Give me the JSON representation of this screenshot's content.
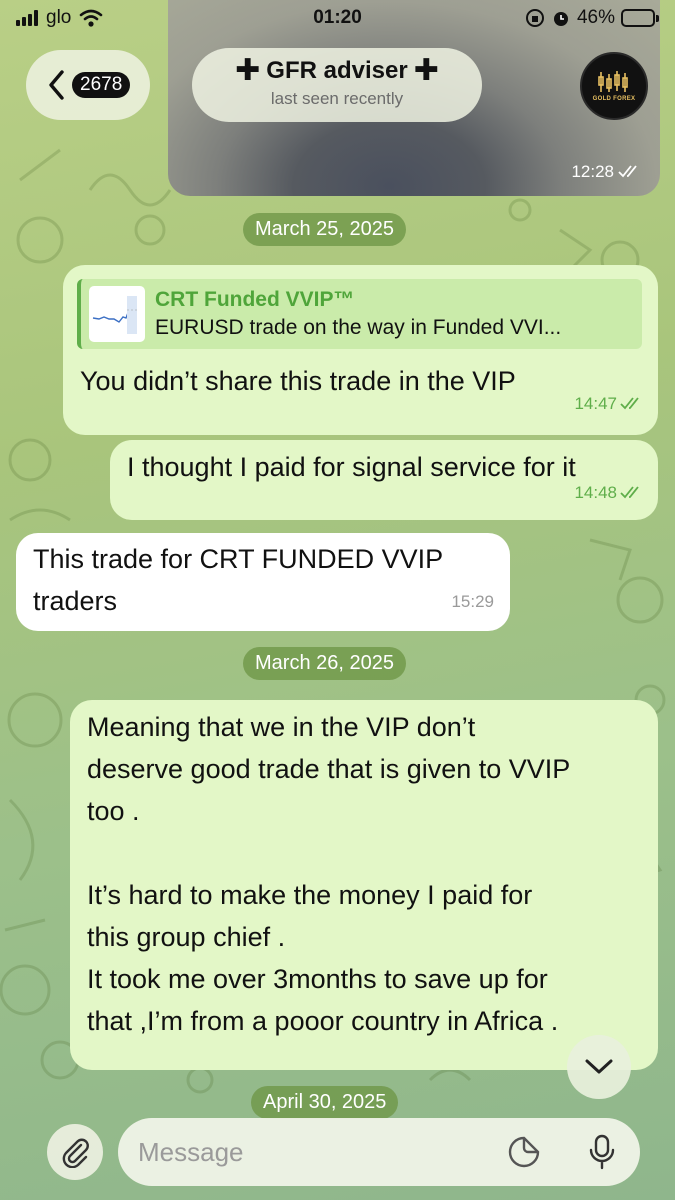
{
  "status_bar": {
    "carrier": "glo",
    "time": "01:20",
    "battery": "46%",
    "battery_level": 0.46
  },
  "header": {
    "back_count": "2678",
    "title": "GFR adviser",
    "subtitle": "last seen recently",
    "avatar_text": "GOLD FOREX"
  },
  "video": {
    "time": "12:28"
  },
  "dates": [
    "March 25, 2025",
    "March 26, 2025",
    "April 30, 2025"
  ],
  "messages": [
    {
      "reply_title": "CRT Funded VVIP™",
      "reply_text": "EURUSD trade on the way in Funded VVI...",
      "text": "You didn’t share this trade in the VIP",
      "time": "14:47"
    },
    {
      "text": "I thought I paid for signal service for it",
      "time": "14:48"
    },
    {
      "lines": [
        "This trade for CRT FUNDED VVIP",
        "traders"
      ],
      "time": "15:29"
    },
    {
      "lines": [
        "Meaning that we in the VIP don’t",
        "deserve good trade that is given to VVIP",
        "too .",
        "",
        "It’s hard to make the money I paid for",
        "this group chief .",
        "It took me over 3months to save up for",
        "that ,I’m from a pooor country in Africa ."
      ]
    }
  ],
  "composer": {
    "placeholder": "Message"
  },
  "colors": {
    "outgoing_bubble": "#e3f7c7",
    "incoming_bubble": "#ffffff",
    "check_marks": "#5fae4a",
    "date_pill": "#6e9646"
  }
}
